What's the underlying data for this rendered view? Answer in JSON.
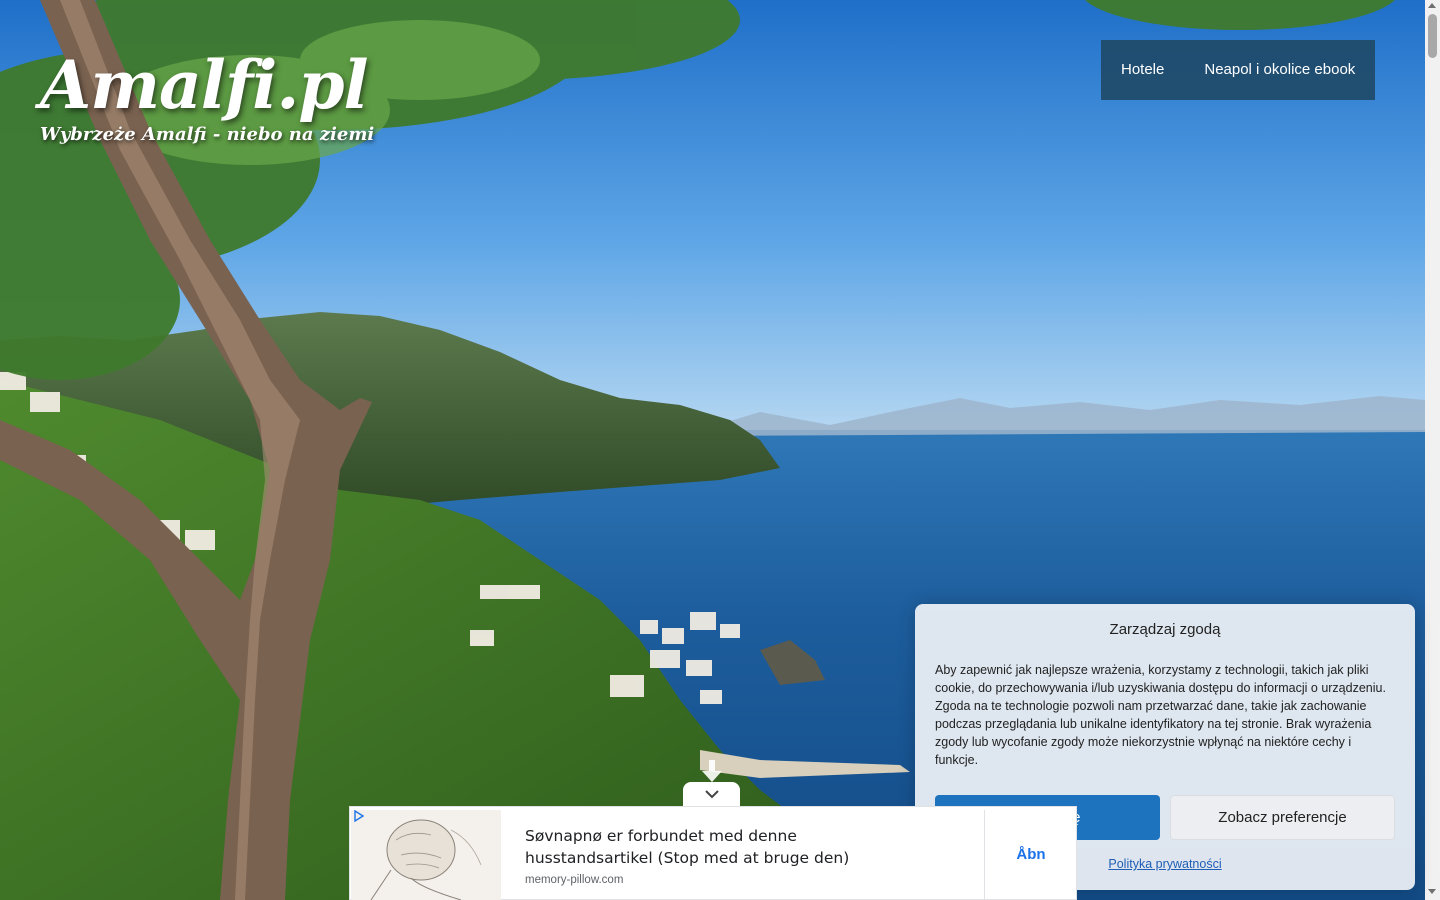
{
  "site": {
    "title": "Amalfi.pl",
    "tagline": "Wybrzeże Amalfi - niebo na ziemi"
  },
  "nav": {
    "items": [
      {
        "label": "Hotele"
      },
      {
        "label": "Neapol i okolice ebook"
      }
    ]
  },
  "consent": {
    "title": "Zarządzaj zgodą",
    "text": "Aby zapewnić jak najlepsze wrażenia, korzystamy z technologii, takich jak pliki cookie, do przechowywania i/lub uzyskiwania dostępu do informacji o urządzeniu. Zgoda na te technologie pozwoli nam przetwarzać dane, takie jak zachowanie podczas przeglądania lub unikalne identyfikatory na tej stronie. Brak wyrażenia zgody lub wycofanie zgody może niekorzystnie wpłynąć na niektóre cechy i funkcje.",
    "accept_label": "Akceptuję",
    "preferences_label": "Zobacz preferencje",
    "privacy_link": "Polityka prywatności"
  },
  "ad": {
    "headline": "Søvnapnø er forbundet med denne husstandsartikel (Stop med at bruge den)",
    "source": "memory-pillow.com",
    "cta": "Åbn"
  },
  "colors": {
    "nav_bg": "#1e4864",
    "accept_bg": "#1e73be",
    "sea": "#1a5fa0",
    "sky": "#2f7fd0"
  },
  "icons": {
    "collapse": "chevron-down-icon",
    "ad_choices": "ad-choices-icon",
    "scroll_hint": "arrow-down-icon"
  }
}
